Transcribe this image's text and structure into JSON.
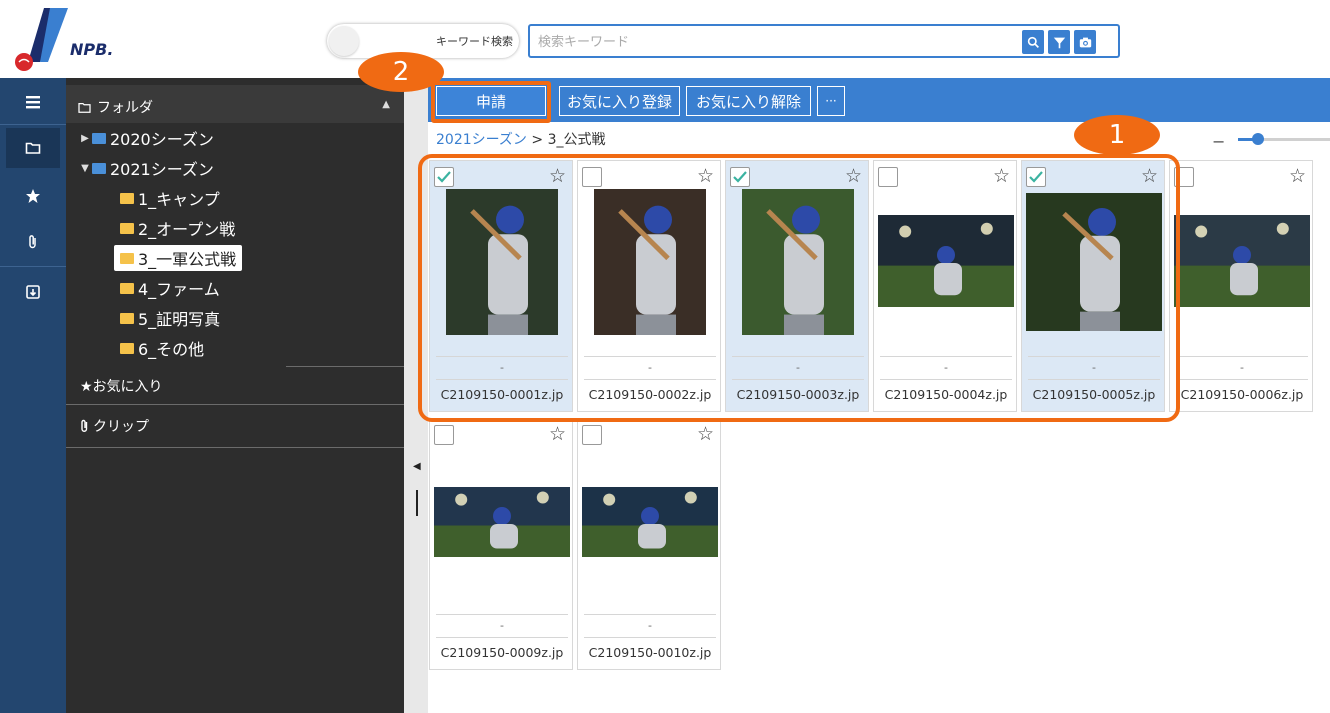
{
  "header": {
    "logo_text": "NPB.",
    "toggle_label": "キーワード検索",
    "search_placeholder": "検索キーワード",
    "search_buttons": [
      "search-icon",
      "filter-icon",
      "camera-icon"
    ]
  },
  "rail": {
    "items": [
      "menu-icon",
      "folder-icon",
      "star-icon",
      "clip-icon",
      "export-icon"
    ],
    "active": "folder-icon"
  },
  "folders": {
    "header": "フォルダ",
    "tree": [
      {
        "label": "2020シーズン",
        "expanded": false,
        "icon": "season-folder"
      },
      {
        "label": "2021シーズン",
        "expanded": true,
        "icon": "season-folder"
      },
      {
        "label": "1_キャンプ"
      },
      {
        "label": "2_オープン戦"
      },
      {
        "label": "3_一軍公式戦",
        "selected": true
      },
      {
        "label": "4_ファーム"
      },
      {
        "label": "5_証明写真"
      },
      {
        "label": "6_その他"
      }
    ],
    "favorites": "★お気に入り",
    "clips": "クリップ"
  },
  "toolbar": {
    "apply": "申請",
    "add_favorite": "お気に入り登録",
    "remove_favorite": "お気に入り解除",
    "more": "···"
  },
  "breadcrumb": {
    "parent": "2021シーズン",
    "sep": " > ",
    "current": "3_公式戦"
  },
  "zoom": {
    "level": 0.2
  },
  "thumbnails": [
    {
      "name": "C2109150-0001z.jp",
      "meta": "-",
      "checked": true
    },
    {
      "name": "C2109150-0002z.jp",
      "meta": "-",
      "checked": false
    },
    {
      "name": "C2109150-0003z.jp",
      "meta": "-",
      "checked": true
    },
    {
      "name": "C2109150-0004z.jp",
      "meta": "-",
      "checked": false
    },
    {
      "name": "C2109150-0005z.jp",
      "meta": "-",
      "checked": true
    },
    {
      "name": "C2109150-0006z.jp",
      "meta": "-",
      "checked": false
    },
    {
      "name": "C2109150-0009z.jp",
      "meta": "-",
      "checked": false
    },
    {
      "name": "C2109150-0010z.jp",
      "meta": "-",
      "checked": false
    }
  ],
  "annotations": {
    "badge1": "1",
    "badge2": "2",
    "color": "#f06a13"
  },
  "colors": {
    "accent": "#3a7fd0",
    "rail": "#23466f",
    "panel": "#2d2d2d"
  }
}
